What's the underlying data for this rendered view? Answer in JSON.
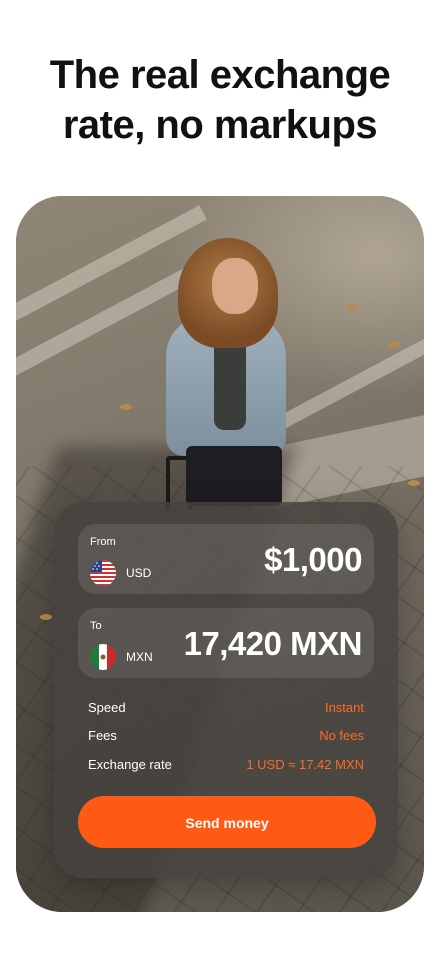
{
  "headline": {
    "line1": "The real exchange",
    "line2": "rate, no markups"
  },
  "converter": {
    "from": {
      "label": "From",
      "currency": "USD",
      "flag_icon": "us-flag-icon",
      "amount": "$1,000"
    },
    "to": {
      "label": "To",
      "currency": "MXN",
      "flag_icon": "mexico-flag-icon",
      "amount": "17,420 MXN"
    },
    "details": [
      {
        "label": "Speed",
        "value": "Instant"
      },
      {
        "label": "Fees",
        "value": "No fees"
      },
      {
        "label": "Exchange rate",
        "value": "1 USD ≈ 17.42 MXN"
      }
    ],
    "button_label": "Send money"
  },
  "colors": {
    "accent": "#ff5a14",
    "value_text": "#ff6a24",
    "card_bg": "#46423e"
  }
}
